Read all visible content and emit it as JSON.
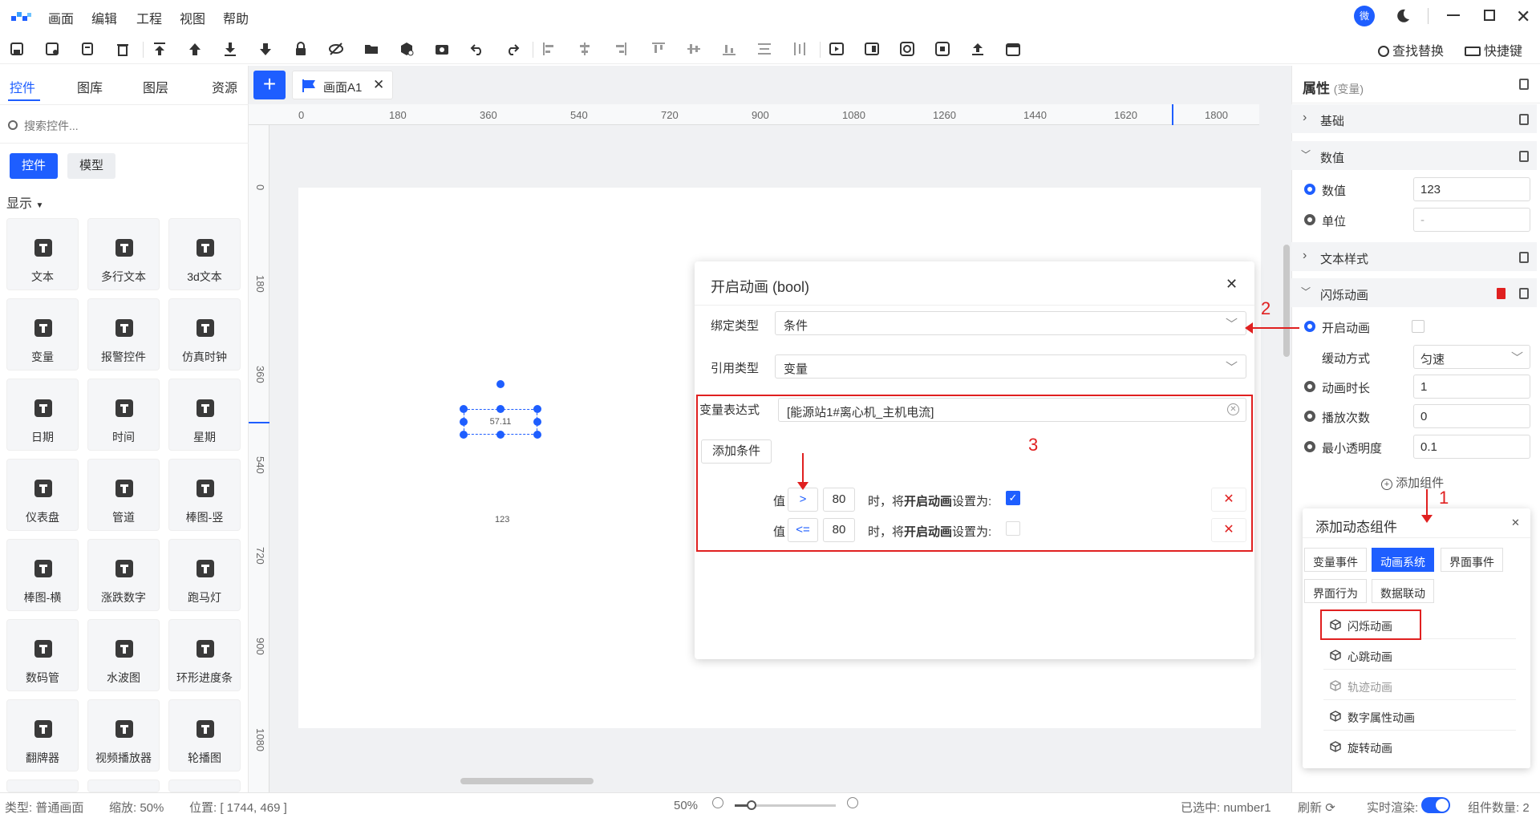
{
  "menu": [
    "画面",
    "编辑",
    "工程",
    "视图",
    "帮助"
  ],
  "toolbar": {
    "search_label": "查找替换",
    "shortcut_label": "快捷键"
  },
  "header": {
    "avatar_text": "微"
  },
  "left_tabs": [
    "控件",
    "图库",
    "图层",
    "资源"
  ],
  "search": {
    "placeholder": "搜索控件..."
  },
  "sub_tabs": [
    "控件",
    "模型"
  ],
  "section_title": "显示",
  "controls": [
    "文本",
    "多行文本",
    "3d文本",
    "变量",
    "报警控件",
    "仿真时钟",
    "日期",
    "时间",
    "星期",
    "仪表盘",
    "管道",
    "棒图-竖",
    "棒图-横",
    "涨跌数字",
    "跑马灯",
    "数码管",
    "水波图",
    "环形进度条",
    "翻牌器",
    "视频播放器",
    "轮播图"
  ],
  "tab": {
    "name": "画面A1"
  },
  "ruler_top": [
    "0",
    "180",
    "360",
    "540",
    "720",
    "900",
    "1080",
    "1260",
    "1440",
    "1620",
    "1800"
  ],
  "ruler_left": [
    "0",
    "180",
    "360",
    "540",
    "720",
    "900",
    "1080"
  ],
  "canvas": {
    "widget_value": "57.11",
    "widget_caption": "123"
  },
  "dialog": {
    "title": "开启动画 (bool)",
    "bind_type_label": "绑定类型",
    "bind_type_value": "条件",
    "ref_type_label": "引用类型",
    "ref_type_value": "变量",
    "expr_label": "变量表达式",
    "expr_value": "[能源站1#离心机_主机电流]",
    "add_cond_label": "添加条件",
    "conditions": [
      {
        "prefix": "值",
        "op": ">",
        "value": "80",
        "text1": "时，将",
        "bold": "开启动画",
        "text2": "设置为:",
        "checked": true
      },
      {
        "prefix": "值",
        "op": "<=",
        "value": "80",
        "text1": "时，将",
        "bold": "开启动画",
        "text2": "设置为:",
        "checked": false
      }
    ]
  },
  "annotations": [
    "1",
    "2",
    "3"
  ],
  "props": {
    "title": "属性",
    "subtitle": "(变量)",
    "sections": {
      "basic": "基础",
      "value": "数值",
      "text_style": "文本样式",
      "blink": "闪烁动画"
    },
    "value_label": "数值",
    "value_value": "123",
    "unit_label": "单位",
    "unit_value": "-",
    "enable_label": "开启动画",
    "ease_label": "缓动方式",
    "ease_value": "匀速",
    "duration_label": "动画时长",
    "duration_value": "1",
    "play_label": "播放次数",
    "play_value": "0",
    "opacity_label": "最小透明度",
    "opacity_value": "0.1",
    "add_comp": "添加组件"
  },
  "popup": {
    "title": "添加动态组件",
    "tabs": [
      "变量事件",
      "动画系统",
      "界面事件",
      "界面行为",
      "数据联动"
    ],
    "items": [
      "闪烁动画",
      "心跳动画",
      "轨迹动画",
      "数字属性动画",
      "旋转动画"
    ]
  },
  "status": {
    "type_label": "类型:",
    "type_value": "普通画面",
    "zoom_label": "缩放:",
    "zoom_value": "50%",
    "pos_label": "位置:",
    "pos_value": "[ 1744, 469 ]",
    "zoom_pct": "50%",
    "selected_label": "已选中:",
    "selected_value": "number1",
    "refresh": "刷新",
    "realtime": "实时渲染:",
    "count_label": "组件数量:",
    "count_value": "2"
  },
  "colors": {
    "accent": "#1e5eff",
    "annotation": "#e02020"
  }
}
